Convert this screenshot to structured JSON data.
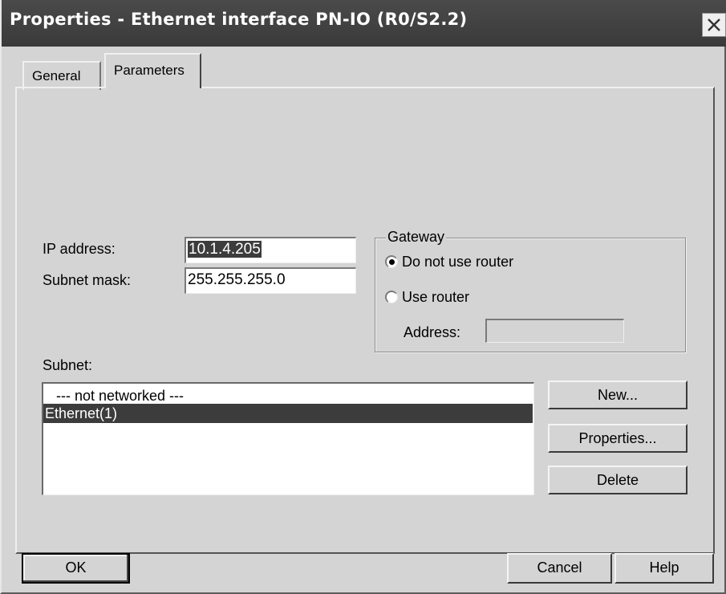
{
  "window": {
    "title": "Properties - Ethernet interface  PN-IO (R0/S2.2)"
  },
  "tabs": [
    {
      "label": "General",
      "active": false
    },
    {
      "label": "Parameters",
      "active": true
    }
  ],
  "ip": {
    "ip_label": "IP address:",
    "ip_value": "10.1.4.205",
    "mask_label": "Subnet mask:",
    "mask_value": "255.255.255.0"
  },
  "gateway": {
    "title": "Gateway",
    "option_no_router": "Do not use router",
    "option_use_router": "Use router",
    "selected": "Do not use router",
    "address_label": "Address:",
    "address_value": ""
  },
  "subnet": {
    "label": "Subnet:",
    "items": [
      "--- not networked ---",
      "Ethernet(1)"
    ],
    "selected": "Ethernet(1)"
  },
  "side_buttons": {
    "new": "New...",
    "properties": "Properties...",
    "delete": "Delete"
  },
  "footer": {
    "ok": "OK",
    "cancel": "Cancel",
    "help": "Help"
  },
  "colors": {
    "titlebar": "#404040",
    "selection": "#3c3c3c",
    "face": "#d4d4d4"
  }
}
